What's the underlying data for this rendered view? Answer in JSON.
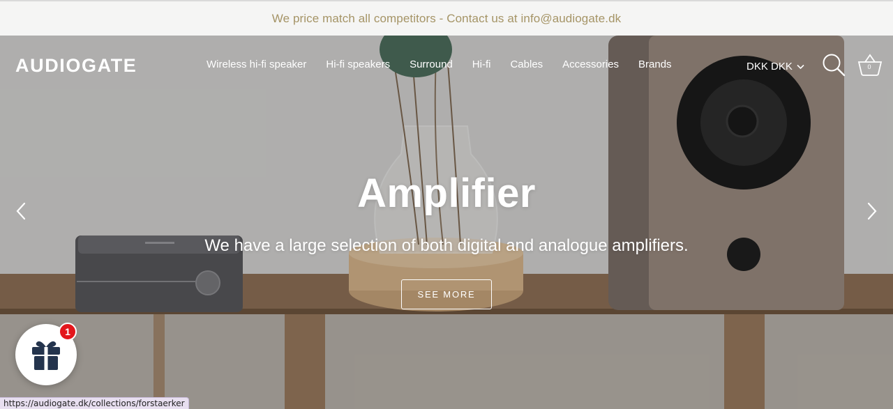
{
  "announcement": {
    "text": "We price match all competitors - Contact us at info@audiogate.dk",
    "color": "#a59466"
  },
  "header": {
    "logo": "AUDIOGATE",
    "nav": [
      "Wireless hi-fi speaker",
      "Hi-fi speakers",
      "Surround",
      "Hi-fi",
      "Cables",
      "Accessories",
      "Brands"
    ],
    "currency": "DKK DKK",
    "currency_icon": "chevron-down-icon",
    "search_icon": "search-icon",
    "cart_icon": "basket-icon",
    "cart_count": "0"
  },
  "hero": {
    "title": "Amplifier",
    "subtitle": "We have a large selection of both digital and analogue amplifiers.",
    "cta_label": "SEE MORE",
    "prev_icon": "chevron-left-icon",
    "next_icon": "chevron-right-icon"
  },
  "gift_widget": {
    "icon": "gift-icon",
    "badge_count": "1",
    "badge_color": "#e3161c"
  },
  "status_bar": {
    "url": "https://audiogate.dk/collections/forstaerker"
  }
}
